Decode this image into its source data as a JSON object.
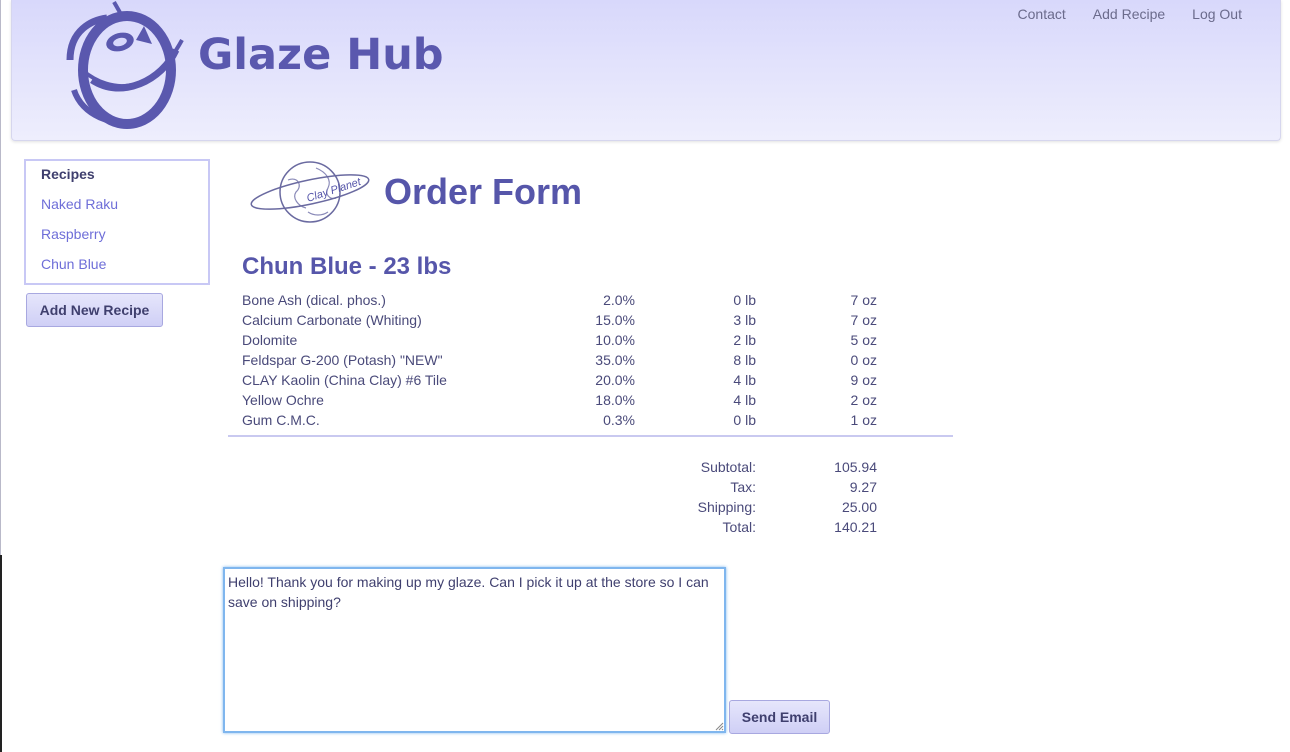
{
  "header": {
    "brand": "Glaze Hub",
    "nav": [
      {
        "label": "Contact"
      },
      {
        "label": "Add Recipe"
      },
      {
        "label": "Log Out"
      }
    ]
  },
  "sidebar": {
    "title": "Recipes",
    "items": [
      {
        "label": "Naked Raku"
      },
      {
        "label": "Raspberry"
      },
      {
        "label": "Chun Blue"
      }
    ],
    "add_button": "Add New Recipe"
  },
  "main": {
    "page_title": "Order Form",
    "planet_logo_text": "Clay Planet",
    "recipe_heading": "Chun Blue - 23 lbs",
    "ingredients": [
      {
        "name": "Bone Ash (dical. phos.)",
        "percent": "2.0%",
        "lb": "0 lb",
        "oz": "7 oz"
      },
      {
        "name": "Calcium Carbonate (Whiting)",
        "percent": "15.0%",
        "lb": "3 lb",
        "oz": "7 oz"
      },
      {
        "name": "Dolomite",
        "percent": "10.0%",
        "lb": "2 lb",
        "oz": "5 oz"
      },
      {
        "name": "Feldspar G-200 (Potash) \"NEW\"",
        "percent": "35.0%",
        "lb": "8 lb",
        "oz": "0 oz"
      },
      {
        "name": "CLAY Kaolin (China Clay) #6 Tile",
        "percent": "20.0%",
        "lb": "4 lb",
        "oz": "9 oz"
      },
      {
        "name": "Yellow Ochre",
        "percent": "18.0%",
        "lb": "4 lb",
        "oz": "2 oz"
      },
      {
        "name": "Gum C.M.C.",
        "percent": "0.3%",
        "lb": "0 lb",
        "oz": "1 oz"
      }
    ],
    "totals": [
      {
        "label": "Subtotal:",
        "value": "105.94"
      },
      {
        "label": "Tax:",
        "value": "9.27"
      },
      {
        "label": "Shipping:",
        "value": "25.00"
      },
      {
        "label": "Total:",
        "value": "140.21"
      }
    ],
    "email": {
      "message": "Hello! Thank you for making up my glaze. Can I pick it up at the store so I can save on shipping?",
      "send_label": "Send Email"
    }
  },
  "colors": {
    "header_bg": "#d8d8fb",
    "brand": "#5a58ae",
    "link": "#6e6ed8",
    "button_bg": "#d8d8f8",
    "focus_border": "#7fb6ee"
  }
}
